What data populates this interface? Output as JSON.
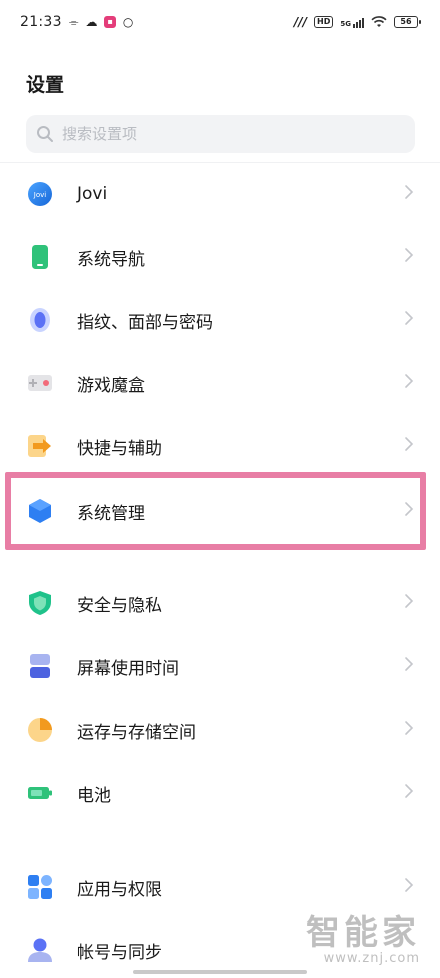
{
  "status_bar": {
    "time": "21:33",
    "signal_text": "ᵐⁿ",
    "hd_label": "HD",
    "net_label": "5G",
    "battery_label": "56"
  },
  "page_title": "设置",
  "search": {
    "placeholder": "搜索设置项",
    "value": ""
  },
  "menu": [
    {
      "label": "Jovi",
      "icon": "jovi-icon"
    },
    {
      "label": "系统导航",
      "icon": "phone-navigation-icon"
    },
    {
      "label": "指纹、面部与密码",
      "icon": "fingerprint-icon"
    },
    {
      "label": "游戏魔盒",
      "icon": "game-box-icon"
    },
    {
      "label": "快捷与辅助",
      "icon": "shortcut-arrow-icon"
    },
    {
      "label": "系统管理",
      "icon": "hexagon-system-icon",
      "highlighted": true
    },
    {
      "label": "安全与隐私",
      "icon": "shield-icon"
    },
    {
      "label": "屏幕使用时间",
      "icon": "hourglass-icon"
    },
    {
      "label": "运存与存储空间",
      "icon": "storage-pie-icon"
    },
    {
      "label": "电池",
      "icon": "battery-icon"
    },
    {
      "label": "应用与权限",
      "icon": "apps-grid-icon"
    },
    {
      "label": "帐号与同步",
      "icon": "account-icon"
    }
  ],
  "watermark": {
    "logo": "智能家",
    "url": "www.znj.com"
  },
  "colors": {
    "highlight_border": "#e87ea5",
    "chevron": "#c4c6cb",
    "search_bg": "#f2f3f5"
  }
}
